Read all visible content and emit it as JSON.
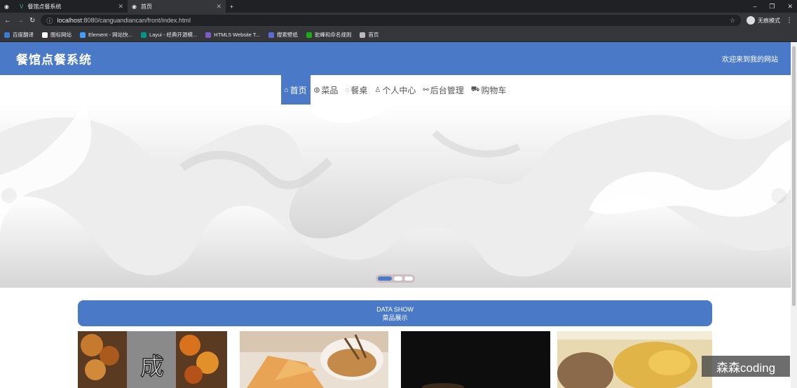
{
  "browser": {
    "tabs": [
      {
        "title": ""
      },
      {
        "title": "餐馆点餐系统"
      },
      {
        "title": "首页"
      }
    ],
    "new_tab": "+",
    "window_controls": [
      "–",
      "❐",
      "✕"
    ],
    "address": {
      "host": "localhost",
      "path": ":8080/canguandiancan/front/index.html"
    },
    "incognito_label": "无痕模式",
    "bookmarks": [
      {
        "label": "百度翻译",
        "color": "#3a7bd5"
      },
      {
        "label": "图标网站",
        "color": "#ffffff"
      },
      {
        "label": "Element - 网站快...",
        "color": "#409eff"
      },
      {
        "label": "Layui - 经典开源模...",
        "color": "#009688"
      },
      {
        "label": "HTML5 Website T...",
        "color": "#7a5cc7"
      },
      {
        "label": "搜索壁纸",
        "color": "#5b6bd6"
      },
      {
        "label": "驼峰和命名规则",
        "color": "#1aad19"
      },
      {
        "label": "首页",
        "color": "#bbbbbb"
      }
    ]
  },
  "site": {
    "title": "餐馆点餐系统",
    "welcome": "欢迎来到我的网站",
    "brand_color": "#4a7ac7",
    "nav": [
      {
        "icon": "⌂",
        "label": "首页",
        "active": true
      },
      {
        "icon": "◍",
        "label": "菜品",
        "active": false
      },
      {
        "icon": "◌",
        "label": "餐桌",
        "active": false
      },
      {
        "icon": "♙",
        "label": "个人中心",
        "active": false
      },
      {
        "icon": "⚯",
        "label": "后台管理",
        "active": false
      },
      {
        "icon": "⛟",
        "label": "购物车",
        "active": false
      }
    ],
    "section": {
      "title_en": "DATA SHOW",
      "title_cn": "菜品展示"
    },
    "carousel": {
      "slides": 3,
      "active_index": 0
    },
    "card_text": "成"
  },
  "watermark": "森森coding"
}
